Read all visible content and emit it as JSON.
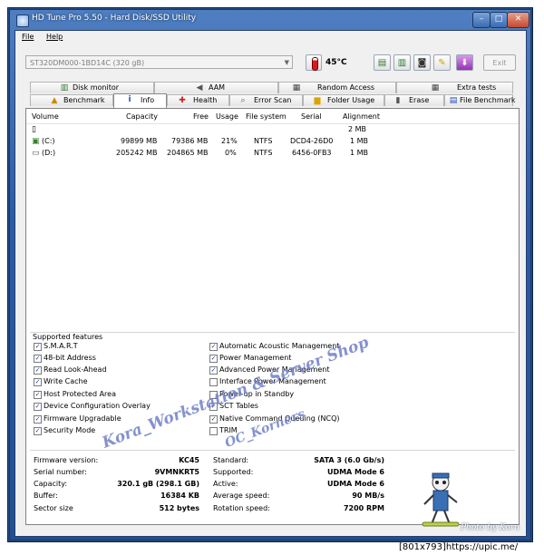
{
  "window": {
    "title": "HD Tune Pro 5.50 - Hard Disk/SSD Utility",
    "min_glyph": "–",
    "max_glyph": "□",
    "close_glyph": "✕"
  },
  "menu": {
    "file": "File",
    "help": "Help"
  },
  "toolbar": {
    "drive": "ST320DM000-1BD14C (320 gB)",
    "temperature": "45°C",
    "exit_label": "Exit"
  },
  "tabs": {
    "row1": [
      {
        "label": "Disk monitor",
        "icon": "chart-icon"
      },
      {
        "label": "AAM",
        "icon": "speaker-icon"
      },
      {
        "label": "Random Access",
        "icon": "grid-icon"
      },
      {
        "label": "Extra tests",
        "icon": "grid-icon"
      }
    ],
    "row2": [
      {
        "label": "Benchmark",
        "icon": "benchmark-icon"
      },
      {
        "label": "Info",
        "icon": "info-icon"
      },
      {
        "label": "Health",
        "icon": "health-icon"
      },
      {
        "label": "Error Scan",
        "icon": "magnifier-icon"
      },
      {
        "label": "Folder Usage",
        "icon": "folder-icon"
      },
      {
        "label": "Erase",
        "icon": "trash-icon"
      },
      {
        "label": "File Benchmark",
        "icon": "file-benchmark-icon"
      }
    ]
  },
  "volumes": {
    "columns": [
      "Volume",
      "Capacity",
      "Free",
      "Usage",
      "File system",
      "Serial",
      "Alignment"
    ],
    "rows": [
      {
        "volume": "",
        "capacity": "",
        "free": "",
        "usage": "",
        "fs": "",
        "serial": "",
        "alignment": "2 MB"
      },
      {
        "volume": "(C:)",
        "capacity": "99899 MB",
        "free": "79386 MB",
        "usage": "21%",
        "fs": "NTFS",
        "serial": "DCD4-26D0",
        "alignment": "1 MB"
      },
      {
        "volume": "(D:)",
        "capacity": "205242 MB",
        "free": "204865 MB",
        "usage": "0%",
        "fs": "NTFS",
        "serial": "6456-0FB3",
        "alignment": "1 MB"
      }
    ]
  },
  "features": {
    "title": "Supported features",
    "left": [
      {
        "label": "S.M.A.R.T",
        "checked": true
      },
      {
        "label": "48-bit Address",
        "checked": true
      },
      {
        "label": "Read Look-Ahead",
        "checked": true
      },
      {
        "label": "Write Cache",
        "checked": true
      },
      {
        "label": "Host Protected Area",
        "checked": true
      },
      {
        "label": "Device Configuration Overlay",
        "checked": true
      },
      {
        "label": "Firmware Upgradable",
        "checked": true
      },
      {
        "label": "Security Mode",
        "checked": true
      }
    ],
    "right": [
      {
        "label": "Automatic Acoustic Management",
        "checked": true
      },
      {
        "label": "Power Management",
        "checked": true
      },
      {
        "label": "Advanced Power Management",
        "checked": true
      },
      {
        "label": "Interface Power Management",
        "checked": false
      },
      {
        "label": "Power-up in Standby",
        "checked": false
      },
      {
        "label": "SCT Tables",
        "checked": true
      },
      {
        "label": "Native Command Queuing (NCQ)",
        "checked": true
      },
      {
        "label": "TRIM",
        "checked": false
      }
    ]
  },
  "info": {
    "left": [
      {
        "key": "Firmware version:",
        "value": "KC45"
      },
      {
        "key": "Serial number:",
        "value": "9VMNKRT5"
      },
      {
        "key": "Capacity:",
        "value": "320.1 gB (298.1 GB)"
      },
      {
        "key": "Buffer:",
        "value": "16384 KB"
      },
      {
        "key": "Sector size",
        "value": "512 bytes"
      }
    ],
    "right": [
      {
        "key": "Standard:",
        "value": "SATA 3 (6.0 Gb/s)"
      },
      {
        "key": "Supported:",
        "value": "UDMA Mode 6"
      },
      {
        "key": "Active:",
        "value": "UDMA Mode 6"
      },
      {
        "key": "Average speed:",
        "value": "90 MB/s"
      },
      {
        "key": "Rotation speed:",
        "value": "7200 RPM"
      }
    ]
  },
  "watermark": {
    "line1": "Kora_Workstation & Server Shop",
    "line2": "OC_Korners"
  },
  "photo_credit": "Photo by Korn",
  "footer": "[801x793]https://upic.me/",
  "colors": {
    "title_bar": "#2b5ca5",
    "watermark": "#6f7fc8",
    "check": "#1a3fa0"
  }
}
